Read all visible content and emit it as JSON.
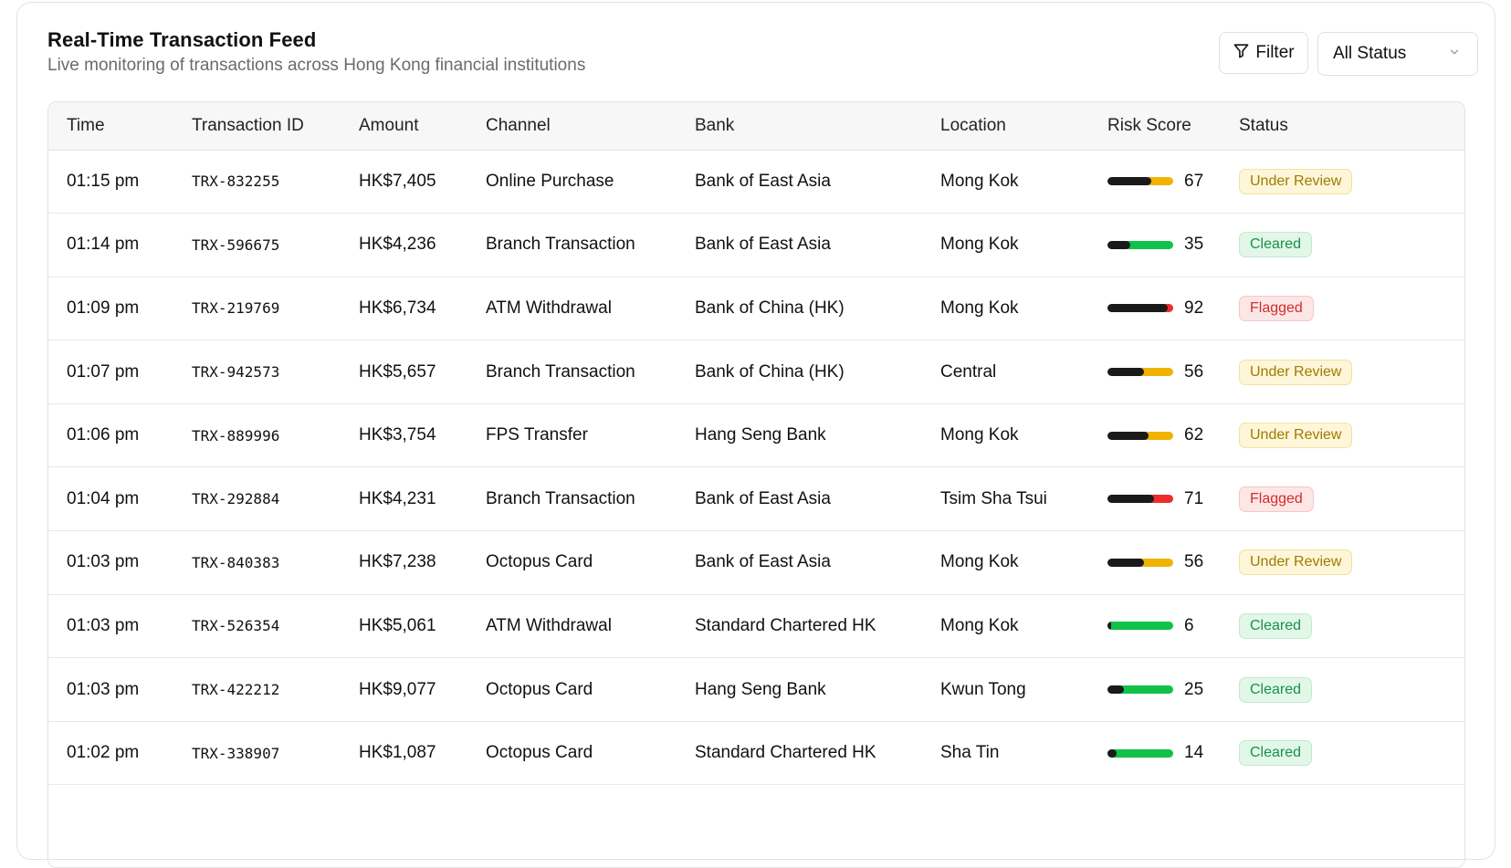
{
  "header": {
    "title": "Real-Time Transaction Feed",
    "subtitle": "Live monitoring of transactions across Hong Kong financial institutions"
  },
  "controls": {
    "filter_label": "Filter",
    "status_select_value": "All Status"
  },
  "table": {
    "columns": [
      "Time",
      "Transaction ID",
      "Amount",
      "Channel",
      "Bank",
      "Location",
      "Risk Score",
      "Status"
    ],
    "rows": [
      {
        "time": "01:15 pm",
        "id": "TRX-832255",
        "amount": "HK$7,405",
        "channel": "Online Purchase",
        "bank": "Bank of East Asia",
        "location": "Mong Kok",
        "risk": 67,
        "status": "Under Review"
      },
      {
        "time": "01:14 pm",
        "id": "TRX-596675",
        "amount": "HK$4,236",
        "channel": "Branch Transaction",
        "bank": "Bank of East Asia",
        "location": "Mong Kok",
        "risk": 35,
        "status": "Cleared"
      },
      {
        "time": "01:09 pm",
        "id": "TRX-219769",
        "amount": "HK$6,734",
        "channel": "ATM Withdrawal",
        "bank": "Bank of China (HK)",
        "location": "Mong Kok",
        "risk": 92,
        "status": "Flagged"
      },
      {
        "time": "01:07 pm",
        "id": "TRX-942573",
        "amount": "HK$5,657",
        "channel": "Branch Transaction",
        "bank": "Bank of China (HK)",
        "location": "Central",
        "risk": 56,
        "status": "Under Review"
      },
      {
        "time": "01:06 pm",
        "id": "TRX-889996",
        "amount": "HK$3,754",
        "channel": "FPS Transfer",
        "bank": "Hang Seng Bank",
        "location": "Mong Kok",
        "risk": 62,
        "status": "Under Review"
      },
      {
        "time": "01:04 pm",
        "id": "TRX-292884",
        "amount": "HK$4,231",
        "channel": "Branch Transaction",
        "bank": "Bank of East Asia",
        "location": "Tsim Sha Tsui",
        "risk": 71,
        "status": "Flagged"
      },
      {
        "time": "01:03 pm",
        "id": "TRX-840383",
        "amount": "HK$7,238",
        "channel": "Octopus Card",
        "bank": "Bank of East Asia",
        "location": "Mong Kok",
        "risk": 56,
        "status": "Under Review"
      },
      {
        "time": "01:03 pm",
        "id": "TRX-526354",
        "amount": "HK$5,061",
        "channel": "ATM Withdrawal",
        "bank": "Standard Chartered HK",
        "location": "Mong Kok",
        "risk": 6,
        "status": "Cleared"
      },
      {
        "time": "01:03 pm",
        "id": "TRX-422212",
        "amount": "HK$9,077",
        "channel": "Octopus Card",
        "bank": "Hang Seng Bank",
        "location": "Kwun Tong",
        "risk": 25,
        "status": "Cleared"
      },
      {
        "time": "01:02 pm",
        "id": "TRX-338907",
        "amount": "HK$1,087",
        "channel": "Octopus Card",
        "bank": "Standard Chartered HK",
        "location": "Sha Tin",
        "risk": 14,
        "status": "Cleared"
      }
    ]
  },
  "colors": {
    "under_review": "#f0b400",
    "cleared": "#10c24a",
    "flagged": "#ef2c2c"
  },
  "icons": {
    "filter": "filter-icon",
    "chevron": "chevron-down-icon"
  }
}
